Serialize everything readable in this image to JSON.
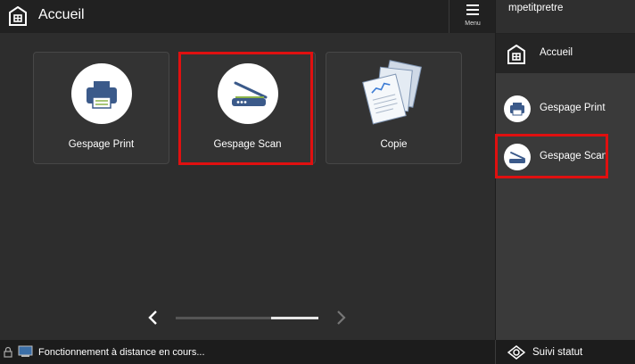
{
  "topbar": {
    "title": "Accueil",
    "menu_label": "Menu"
  },
  "tiles": [
    {
      "label": "Gespage Print",
      "icon": "printer-icon"
    },
    {
      "label": "Gespage Scan",
      "icon": "scanner-icon"
    },
    {
      "label": "Copie",
      "icon": "copy-documents-icon"
    }
  ],
  "pager": {
    "position": 2,
    "count": 3
  },
  "side": {
    "user": "mpetitpretre",
    "home_label": "Accueil",
    "items": [
      {
        "label": "Gespage Print",
        "icon": "printer-icon"
      },
      {
        "label": "Gespage Scan",
        "icon": "scanner-icon"
      }
    ]
  },
  "status": {
    "message": "Fonctionnement à distance en cours...",
    "status_button": "Suivi statut"
  },
  "colors": {
    "highlight": "#e01010",
    "background": "#2d2d2d",
    "topbar": "#212121",
    "accent_blue": "#3b5a8a"
  }
}
